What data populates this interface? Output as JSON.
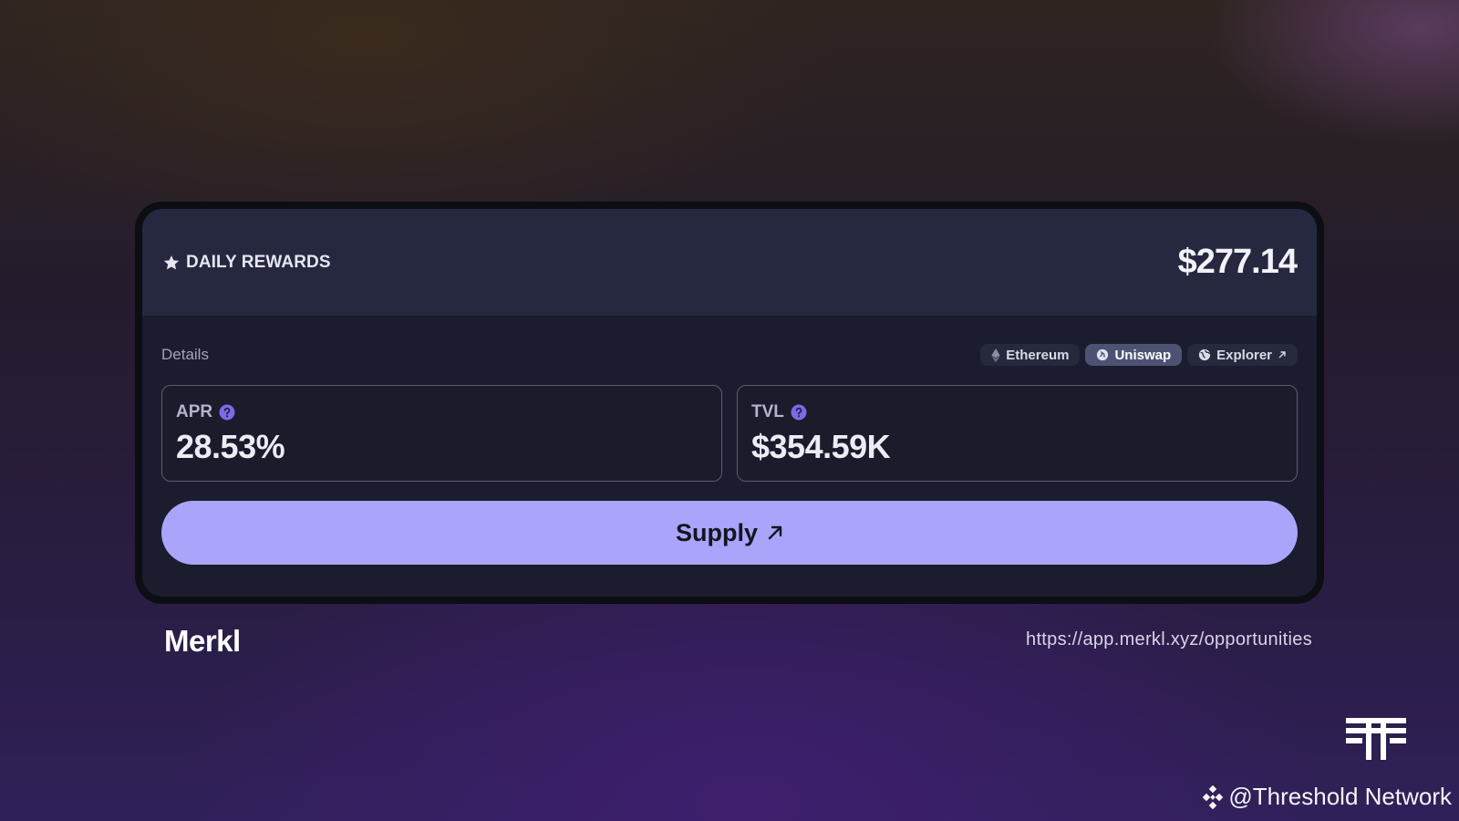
{
  "card": {
    "header_label": "DAILY REWARDS",
    "header_amount": "$277.14",
    "details_label": "Details",
    "tags": [
      {
        "label": "Ethereum",
        "icon": "ethereum-icon"
      },
      {
        "label": "Uniswap",
        "icon": "uniswap-icon"
      },
      {
        "label": "Explorer",
        "icon": "globe-icon",
        "trailing_icon": "arrow-up-right-icon"
      }
    ],
    "stats": {
      "apr": {
        "label": "APR",
        "value": "28.53%"
      },
      "tvl": {
        "label": "TVL",
        "value": "$354.59K"
      }
    },
    "supply_label": "Supply"
  },
  "footer": {
    "brand": "Merkl",
    "url": "https://app.merkl.xyz/opportunities"
  },
  "watermark": {
    "text": "@Threshold Network"
  },
  "colors": {
    "accent": "#aaa4fb",
    "help_icon": "#7a6ae8",
    "card_bg": "#1b1c2d",
    "header_bg": "#25283f"
  }
}
